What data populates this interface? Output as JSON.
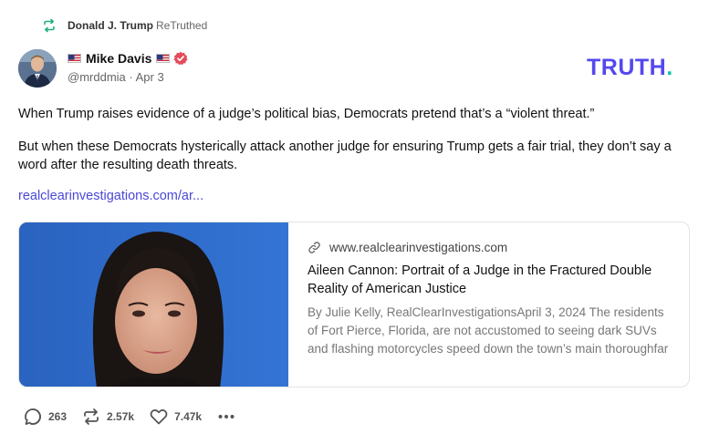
{
  "retruth": {
    "icon": "retruth-icon",
    "name": "Donald J. Trump",
    "label": "ReTruthed"
  },
  "author": {
    "display_name": "Mike Davis",
    "handle": "@mrddmia",
    "date": "Apr 3",
    "handle_date": "@mrddmia · Apr 3",
    "verified_color": "#e54b5b"
  },
  "logo": {
    "text": "TRUTH",
    "dot": ".",
    "colors": {
      "text": "#5448ee",
      "dot": "#14c4a4"
    }
  },
  "post": {
    "paragraphs": [
      "When Trump raises evidence of a judge’s political bias, Democrats pretend that’s a “violent threat.”",
      "But when these Democrats hysterically attack another judge for ensuring Trump gets a fair trial, they don’t say a word after the resulting death threats."
    ],
    "link": "realclearinvestigations.com/ar..."
  },
  "card": {
    "domain": "www.realclearinvestigations.com",
    "title": "Aileen Cannon: Portrait of a Judge in the Fractured Double Reality of American Justice",
    "description": "By Julie Kelly, RealClearInvestigationsApril 3, 2024 The residents of Fort Pierce, Florida, are not accustomed to seeing dark SUVs and flashing motorcycles speed down the town’s main thoroughfar"
  },
  "actions": {
    "replies": "263",
    "retruths": "2.57k",
    "likes": "7.47k"
  }
}
